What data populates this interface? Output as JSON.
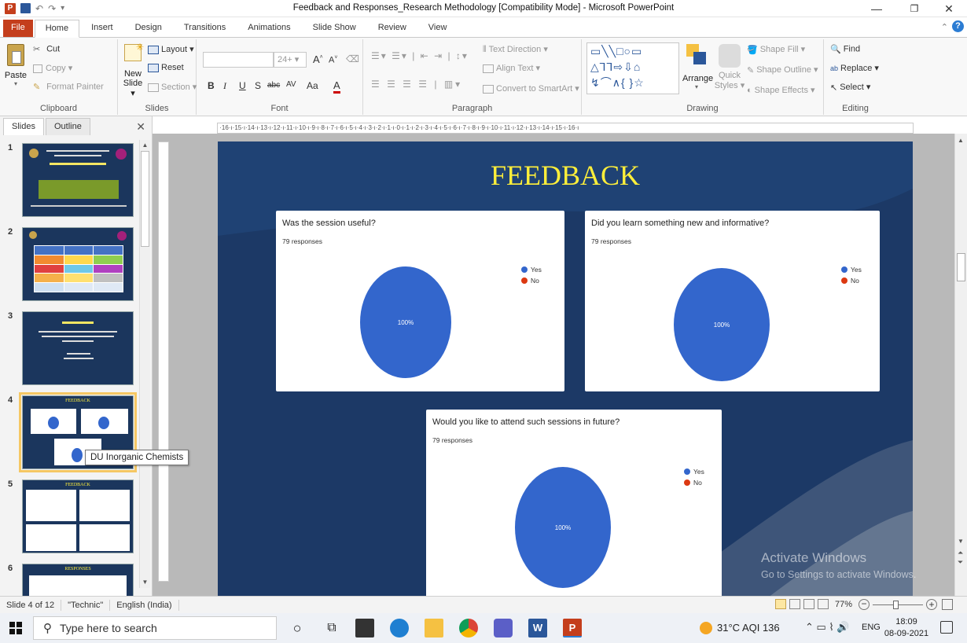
{
  "window": {
    "title": "Feedback and Responses_Research Methodology [Compatibility Mode] - Microsoft PowerPoint",
    "minimize_glyph": "—",
    "restore_glyph": "❐",
    "close_glyph": "✕",
    "quick_access": {
      "undo_glyph": "↶",
      "redo_glyph": "↷",
      "more_glyph": "▾"
    }
  },
  "tabs": [
    "File",
    "Home",
    "Insert",
    "Design",
    "Transitions",
    "Animations",
    "Slide Show",
    "Review",
    "View"
  ],
  "ribbon": {
    "clipboard": {
      "label": "Clipboard",
      "paste": "Paste",
      "cut": "Cut",
      "copy": "Copy ▾",
      "format_painter": "Format Painter"
    },
    "slides": {
      "label": "Slides",
      "new_slide": "New",
      "new_slide_2": "Slide ▾",
      "layout": "Layout ▾",
      "reset": "Reset",
      "section": "Section ▾"
    },
    "font": {
      "label": "Font",
      "size": "24+",
      "b": "B",
      "i": "I",
      "u": "U",
      "s": "S",
      "abc": "abc",
      "av": "AV",
      "aa": "Aa",
      "a": "A"
    },
    "paragraph": {
      "label": "Paragraph",
      "text_direction": "Text Direction ▾",
      "align_text": "Align Text ▾",
      "convert_smartart": "Convert to SmartArt ▾"
    },
    "drawing": {
      "label": "Drawing",
      "arrange": "Arrange",
      "quick_styles": "Quick",
      "quick_styles_2": "Styles ▾",
      "shape_fill": "Shape Fill ▾",
      "shape_outline": "Shape Outline ▾",
      "shape_effects": "Shape Effects ▾"
    },
    "editing": {
      "label": "Editing",
      "find": "Find",
      "replace": "Replace ▾",
      "select": "Select ▾"
    }
  },
  "panel": {
    "tab_slides": "Slides",
    "tab_outline": "Outline",
    "close_glyph": "✕",
    "thumbnails": [
      {
        "num": "1"
      },
      {
        "num": "2"
      },
      {
        "num": "3"
      },
      {
        "num": "4",
        "title": "FEEDBACK"
      },
      {
        "num": "5",
        "title": "FEEDBACK"
      },
      {
        "num": "6",
        "title": "RESPONSES"
      }
    ]
  },
  "tooltip": "DU Inorganic Chemists",
  "slide": {
    "heading": "FEEDBACK",
    "cards": [
      {
        "question": "Was the session useful?",
        "responses": "79 responses",
        "legend": [
          "Yes",
          "No"
        ],
        "pct": "100%"
      },
      {
        "question": "Did you learn something new and informative?",
        "responses": "79 responses",
        "legend": [
          "Yes",
          "No"
        ],
        "pct": "100%"
      },
      {
        "question": "Would you like to attend such sessions in future?",
        "responses": "79 responses",
        "legend": [
          "Yes",
          "No"
        ],
        "pct": "100%"
      }
    ]
  },
  "watermark": {
    "line1": "Activate Windows",
    "line2": "Go to Settings to activate Windows."
  },
  "status": {
    "slide": "Slide 4 of 12",
    "theme": "\"Technic\"",
    "lang": "English (India)",
    "zoom": "77%"
  },
  "taskbar": {
    "search_placeholder": "Type here to search",
    "weather": "31°C AQI 136",
    "ime": "ENG",
    "time": "18:09",
    "date": "08-09-2021"
  },
  "colors": {
    "file_tab": "#c43e1c",
    "slide_bg": "#1c3966",
    "heading": "#ffef3a",
    "yes": "#3366cc",
    "no": "#dc3912",
    "thumb_sel": "#f5c763"
  },
  "icons": [
    "powerpoint-icon",
    "save-icon",
    "undo-icon",
    "redo-icon",
    "help-icon",
    "paste-icon",
    "cut-icon",
    "copy-icon",
    "format-painter-icon",
    "new-slide-icon",
    "layout-icon",
    "reset-icon",
    "section-icon",
    "find-icon",
    "replace-icon",
    "select-icon",
    "windows-start-icon",
    "search-icon",
    "cortana-icon",
    "task-view-icon",
    "store-icon",
    "edge-icon",
    "explorer-icon",
    "chrome-icon",
    "teams-icon",
    "word-icon",
    "ppt-taskbar-icon",
    "weather-icon",
    "notification-icon"
  ]
}
